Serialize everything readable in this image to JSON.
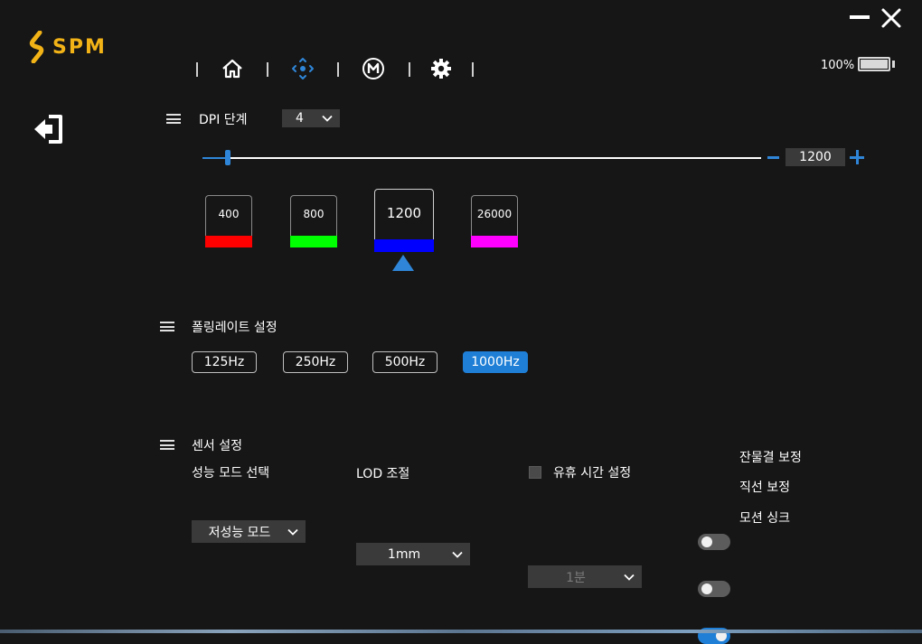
{
  "app": {
    "logo_text": "SPM",
    "brand_color": "#f2b317",
    "accent_color": "#1f7fd6"
  },
  "window": {
    "minimize_icon": "minimize-icon",
    "close_icon": "close-icon"
  },
  "nav": {
    "items": [
      {
        "icon": "home-icon",
        "active": false
      },
      {
        "icon": "dpi-crosshair-icon",
        "active": true
      },
      {
        "icon": "macro-m-icon",
        "active": false
      },
      {
        "icon": "gear-icon",
        "active": false
      }
    ],
    "battery_percent": "100%",
    "battery_level": 1.0
  },
  "dpi": {
    "title": "DPI 단계",
    "stage_count": "4",
    "current_value": "1200",
    "slider_level": 0.045,
    "stages": [
      {
        "value": "400",
        "color": "#ff0000",
        "selected": false
      },
      {
        "value": "800",
        "color": "#00ff00",
        "selected": false
      },
      {
        "value": "1200",
        "color": "#0000ff",
        "selected": true
      },
      {
        "value": "26000",
        "color": "#ff00ff",
        "selected": false
      }
    ]
  },
  "polling": {
    "title": "폴링레이트 설정",
    "options": [
      "125Hz",
      "250Hz",
      "500Hz",
      "1000Hz"
    ],
    "selected": "1000Hz"
  },
  "sensor": {
    "title": "센서 설정",
    "performance_label": "성능 모드 선택",
    "performance_value": "저성능 모드",
    "lod_label": "LOD 조절",
    "lod_value": "1mm",
    "idle_label": "유휴 시간 설정",
    "idle_value": "1분",
    "idle_checked": false,
    "toggles": [
      {
        "label": "잔물결 보정",
        "on": false
      },
      {
        "label": "직선 보정",
        "on": false
      },
      {
        "label": "모션 싱크",
        "on": true
      }
    ]
  }
}
